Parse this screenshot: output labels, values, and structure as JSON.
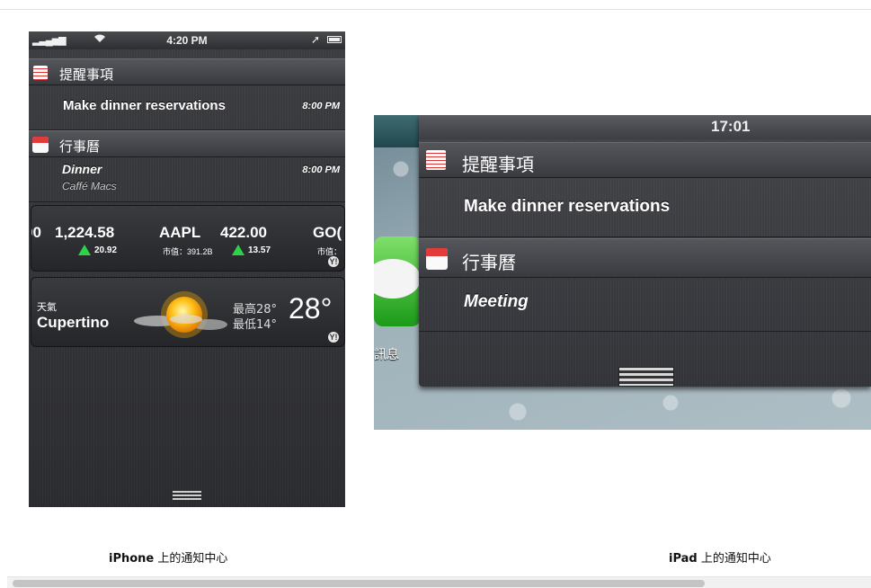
{
  "iphone": {
    "status": {
      "time": "4:20 PM"
    },
    "reminders": {
      "header": "提醒事項",
      "item_title": "Make dinner reservations",
      "item_time": "8:00 PM"
    },
    "calendar": {
      "header": "行事曆",
      "event_title": "Dinner",
      "event_location": "Caffé Macs",
      "event_time": "8:00 PM"
    },
    "stocks": {
      "partial_left": "00",
      "first_value": "1,224.58",
      "first_change": "20.92",
      "aapl_symbol": "AAPL",
      "aapl_price": "422.00",
      "aapl_cap": "市值：391.2B",
      "aapl_change": "13.57",
      "partial_right": "GO(",
      "partial_right_cap": "市值：",
      "change_color": "#2bd24a"
    },
    "weather": {
      "label": "天氣",
      "city": "Cupertino",
      "high": "最高28°",
      "low": "最低14°",
      "temp": "28°"
    }
  },
  "ipad": {
    "status_time": "17:01",
    "reminders_header": "提醒事項",
    "reminder_item": "Make dinner reservations",
    "calendar_header": "行事曆",
    "calendar_item": "Meeting",
    "app_label": "訊息"
  },
  "captions": {
    "iphone_bold": "iPhone",
    "iphone_rest": " 上的通知中心",
    "ipad_bold": "iPad",
    "ipad_rest": " 上的通知中心"
  },
  "icons": [
    "signal-icon",
    "wifi-icon",
    "location-arrow-icon",
    "battery-icon",
    "reminders-icon",
    "calendar-icon",
    "stock-up-icon",
    "yahoo-icon",
    "sun-cloud-icon",
    "grabber-icon",
    "messages-app-icon"
  ]
}
